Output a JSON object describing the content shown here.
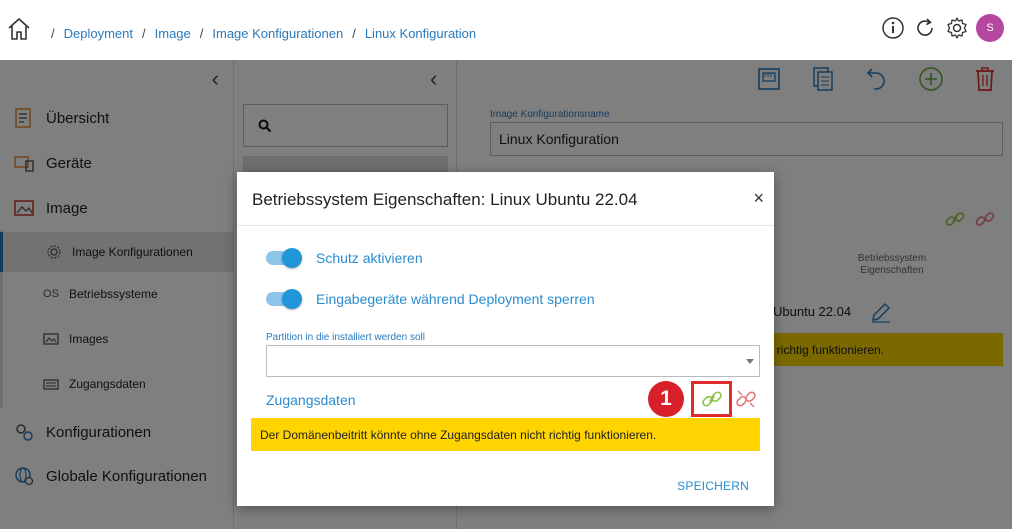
{
  "breadcrumb": {
    "items": [
      {
        "label": "Deployment"
      },
      {
        "label": "Image"
      },
      {
        "label": "Image Konfigurationen"
      },
      {
        "label": "Linux Konfiguration"
      }
    ],
    "separator": "/"
  },
  "header": {
    "avatar_initial": "S",
    "avatar_color": "#b5479e",
    "icons": [
      "info-icon",
      "refresh-icon",
      "settings-icon"
    ]
  },
  "sidebar": {
    "collapse_glyph": "‹",
    "items": [
      {
        "label": "Übersicht",
        "icon": "overview-icon"
      },
      {
        "label": "Geräte",
        "icon": "devices-icon"
      },
      {
        "label": "Image",
        "icon": "image-icon"
      },
      {
        "label": "Konfigurationen",
        "icon": "configurations-icon"
      },
      {
        "label": "Globale Konfigurationen",
        "icon": "global-configurations-icon"
      }
    ],
    "subitems": [
      {
        "label": "Image Konfigurationen",
        "icon": "gear-icon",
        "active": true
      },
      {
        "label": "Betriebssysteme",
        "icon_text": "OS"
      },
      {
        "label": "Images",
        "icon": "picture-icon"
      },
      {
        "label": "Zugangsdaten",
        "icon": "keyboard-icon"
      }
    ]
  },
  "middle": {
    "collapse_glyph": "‹",
    "search_icon": "search-icon"
  },
  "main": {
    "toolbar_icons": [
      "network-icon",
      "copy-icon",
      "undo-icon",
      "add-icon",
      "delete-icon"
    ],
    "config_name_label": "Image Konfigurationsname",
    "config_name_value": "Linux Konfiguration",
    "column_header": "Betriebssystem Eigenschaften",
    "os_value": "Ubuntu 22.04",
    "warning_partial": "t richtig funktionieren."
  },
  "dialog": {
    "title": "Betriebssystem Eigenschaften: Linux Ubuntu 22.04",
    "close_glyph": "×",
    "toggles": [
      {
        "label": "Schutz aktivieren",
        "on": true
      },
      {
        "label": "Eingabegeräte während Deployment sperren",
        "on": true
      }
    ],
    "partition_label": "Partition in die installiert werden soll",
    "partition_value": "",
    "credentials_label": "Zugangsdaten",
    "annotation_number": "1",
    "warning": "Der Domänenbeitritt könnte ohne Zugangsdaten nicht richtig funktionieren.",
    "save_label": "SPEICHERN"
  },
  "colors": {
    "accent": "#2a8ccf",
    "warning": "#ffd400",
    "link_green": "#8bc34a",
    "unlink_red": "#e57373",
    "annotation_red": "#d9202a"
  }
}
